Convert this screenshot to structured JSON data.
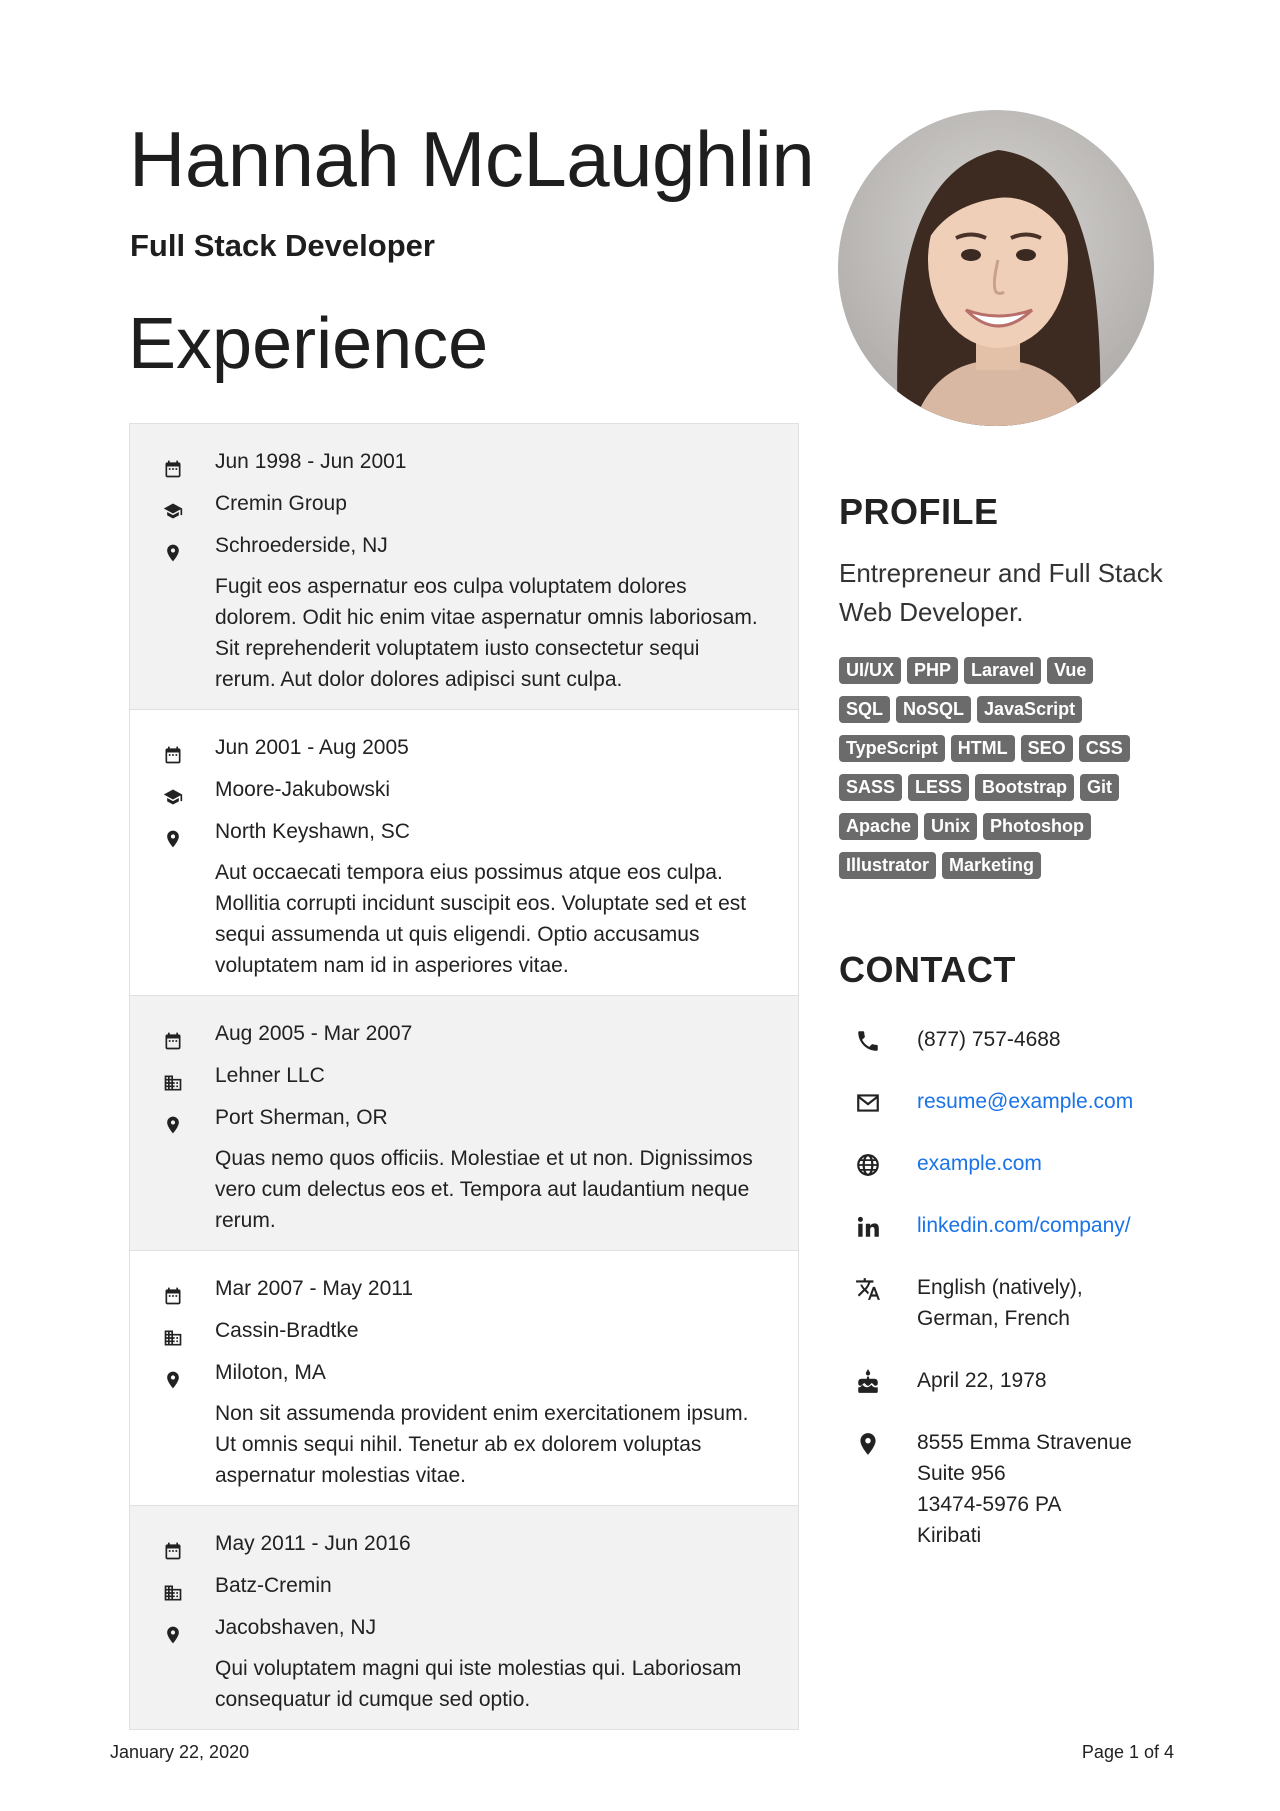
{
  "header": {
    "name": "Hannah McLaughlin",
    "role": "Full Stack Developer"
  },
  "experience": {
    "title": "Experience",
    "jobs": [
      {
        "dates": "Jun 1998 - Jun 2001",
        "company": "Cremin Group",
        "company_icon": "school-icon",
        "location": "Schroederside, NJ",
        "description": "Fugit eos aspernatur eos culpa voluptatem dolores dolorem. Odit hic enim vitae aspernatur omnis laboriosam. Sit reprehenderit voluptatem iusto consectetur sequi rerum. Aut dolor dolores adipisci sunt culpa."
      },
      {
        "dates": "Jun 2001 - Aug 2005",
        "company": "Moore-Jakubowski",
        "company_icon": "school-icon",
        "location": "North Keyshawn, SC",
        "description": "Aut occaecati tempora eius possimus atque eos culpa. Mollitia corrupti incidunt suscipit eos. Voluptate sed et est sequi assumenda ut quis eligendi. Optio accusamus voluptatem nam id in asperiores vitae."
      },
      {
        "dates": "Aug 2005 - Mar 2007",
        "company": "Lehner LLC",
        "company_icon": "building-icon",
        "location": "Port Sherman, OR",
        "description": "Quas nemo quos officiis. Molestiae et ut non. Dignissimos vero cum delectus eos et. Tempora aut laudantium neque rerum."
      },
      {
        "dates": "Mar 2007 - May 2011",
        "company": "Cassin-Bradtke",
        "company_icon": "building-icon",
        "location": "Miloton, MA",
        "description": "Non sit assumenda provident enim exercitationem ipsum. Ut omnis sequi nihil. Tenetur ab ex dolorem voluptas aspernatur molestias vitae."
      },
      {
        "dates": "May 2011 - Jun 2016",
        "company": "Batz-Cremin",
        "company_icon": "building-icon",
        "location": "Jacobshaven, NJ",
        "description": "Qui voluptatem magni qui iste molestias qui. Laboriosam consequatur id cumque sed optio."
      }
    ]
  },
  "profile": {
    "title": "PROFILE",
    "summary": "Entrepreneur and Full Stack Web Developer.",
    "skills": [
      [
        "UI/UX",
        "PHP",
        "Laravel",
        "Vue"
      ],
      [
        "SQL",
        "NoSQL",
        "JavaScript"
      ],
      [
        "TypeScript",
        "HTML",
        "SEO",
        "CSS"
      ],
      [
        "SASS",
        "LESS",
        "Bootstrap",
        "Git"
      ],
      [
        "Apache",
        "Unix",
        "Photoshop"
      ],
      [
        "Illustrator",
        "Marketing"
      ]
    ]
  },
  "contact": {
    "title": "CONTACT",
    "phone": "(877) 757-4688",
    "email": "resume@example.com",
    "website": "example.com",
    "linkedin": "linkedin.com/company/",
    "languages_line1": "English (natively),",
    "languages_line2": "German, French",
    "birthday": "April 22, 1978",
    "address_line1": "8555 Emma Stravenue",
    "address_line2": "Suite 956",
    "address_line3": "13474-5976 PA",
    "address_line4": "Kiribati",
    "link_color": "#1a73e8"
  },
  "footer": {
    "date": "January 22, 2020",
    "page": "Page 1 of 4"
  }
}
